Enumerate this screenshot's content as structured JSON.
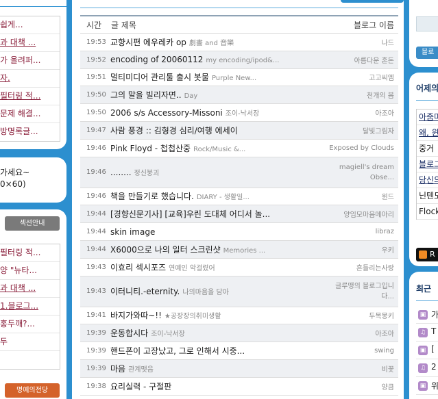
{
  "left_top": {
    "items": [
      {
        "text": "쉽게...",
        "u": false
      },
      {
        "text": "과 대책 ...",
        "u": true
      },
      {
        "text": "가 올려퍼...",
        "u": false
      },
      {
        "text": "자.",
        "u": true
      },
      {
        "text": "필터링 적...",
        "u": true
      },
      {
        "text": "문제 해결...",
        "u": false
      },
      {
        "text": "방명록글...",
        "u": false
      }
    ]
  },
  "left_mid": {
    "line1": "가세요~",
    "line2": "0×60)"
  },
  "left_bot": {
    "section_button": "섹션안내",
    "items": [
      {
        "text": "필터링 적...",
        "u": false
      },
      {
        "text": "양 \"뉴타...",
        "u": false
      },
      {
        "text": "과 대책 ...",
        "u": true
      },
      {
        "text": "1.블로그...",
        "u": true
      },
      {
        "text": "홍두깨?...",
        "u": false
      },
      {
        "text": "두",
        "u": false
      },
      {
        "text": "",
        "u": false
      }
    ],
    "hall_button": "명예의전당"
  },
  "feed": {
    "header": {
      "time": "시간",
      "title": "글 제목",
      "blog": "블로그 이름"
    },
    "rows": [
      {
        "time": "19:53",
        "title": "교향시편 에우레카 op",
        "cat": "劇畵 and 音樂",
        "blog": "나드",
        "tall": false
      },
      {
        "time": "19:52",
        "title": "encoding of 20060112",
        "cat": "my encoding/ipod&...",
        "blog": "아름다운 혼돈",
        "tall": false
      },
      {
        "time": "19:51",
        "title": "멀티미디어 관리툴 출시 봇물",
        "cat": "Purple New...",
        "blog": "고고씨엠",
        "tall": false
      },
      {
        "time": "19:50",
        "title": "그의 말을 빌리자면..",
        "cat": "Day",
        "blog": "천개의 봄",
        "tall": false
      },
      {
        "time": "19:50",
        "title": "2006 s/s Accessory-Missoni",
        "cat": "조이-낙서장",
        "blog": "아조아",
        "tall": false
      },
      {
        "time": "19:47",
        "title": "사람 풍경 :: 김형경 심리/여행 에세이",
        "cat": "",
        "blog": "달빛그림자",
        "tall": false
      },
      {
        "time": "19:46",
        "title": "Pink Floyd - 첩첩산중",
        "cat": "Rock/Music &...",
        "blog": "Exposed by Clouds",
        "tall": false
      },
      {
        "time": "19:46",
        "title": "........",
        "cat": "정신붕괴",
        "blog": "magiell's dream Obse...",
        "tall": true
      },
      {
        "time": "19:46",
        "title": "책을 만들기로 했습니다.",
        "cat": "DIARY - 생활일...",
        "blog": "윈드",
        "tall": false
      },
      {
        "time": "19:44",
        "title": "[경향신문기사] [교육]우린 도대체 어디서 놀...",
        "cat": "",
        "blog": "양임모마음메아리",
        "tall": false
      },
      {
        "time": "19:44",
        "title": "skin image",
        "cat": "",
        "blog": "libraz",
        "tall": false
      },
      {
        "time": "19:44",
        "title": "X6000으로 나의 일터 스크린샷",
        "cat": "Memories ...",
        "blog": "우키",
        "tall": false
      },
      {
        "time": "19:43",
        "title": "이효리 섹시포즈",
        "cat": "연예인 악걸렸어",
        "blog": "흔들리는사랑",
        "tall": false
      },
      {
        "time": "19:43",
        "title": "이터니티.-eternity.",
        "cat": "나의마음을 담아",
        "blog": "글루맹의 블로그입니다...",
        "tall": true
      },
      {
        "time": "19:41",
        "title": "바지가와따~!!",
        "cat": "★공장장의취미생활",
        "blog": "두목몽키",
        "tall": false
      },
      {
        "time": "19:39",
        "title": "운동합시다",
        "cat": "조이-낙서장",
        "blog": "아조아",
        "tall": false
      },
      {
        "time": "19:39",
        "title": "핸드폰이 고장났고, 그로 인해서 시중...",
        "cat": "",
        "blog": "swing",
        "tall": false
      },
      {
        "time": "19:39",
        "title": "마음",
        "cat": "관계맺음",
        "blog": "비꽃",
        "tall": false
      },
      {
        "time": "19:38",
        "title": "요리실력 - 구절판",
        "cat": "",
        "blog": "양큼",
        "tall": false
      }
    ]
  },
  "right_top": {
    "button": "블로"
  },
  "right_mid": {
    "title": "어제의",
    "items": [
      {
        "text": "아줌마",
        "u": true
      },
      {
        "text": "왜, 윈",
        "u": true
      },
      {
        "text": "중거",
        "u": false
      },
      {
        "text": "블로그",
        "u": true
      },
      {
        "text": "당신의",
        "u": true
      },
      {
        "text": "닌텐도",
        "u": false
      },
      {
        "text": "Flock",
        "u": false
      }
    ],
    "rss_text": "R"
  },
  "right_bot": {
    "title": "최근",
    "items": [
      {
        "icon": "tv-icon",
        "text": "가"
      },
      {
        "icon": "music-icon",
        "text": "T"
      },
      {
        "icon": "tv-icon",
        "text": "["
      },
      {
        "icon": "music-icon",
        "text": "2"
      },
      {
        "icon": "tv-icon",
        "text": "위"
      }
    ]
  },
  "colors": {
    "background": "#2c8fcf",
    "link": "#8a1e3a",
    "even_row": "#eef0f3",
    "orange": "#d4622a"
  }
}
